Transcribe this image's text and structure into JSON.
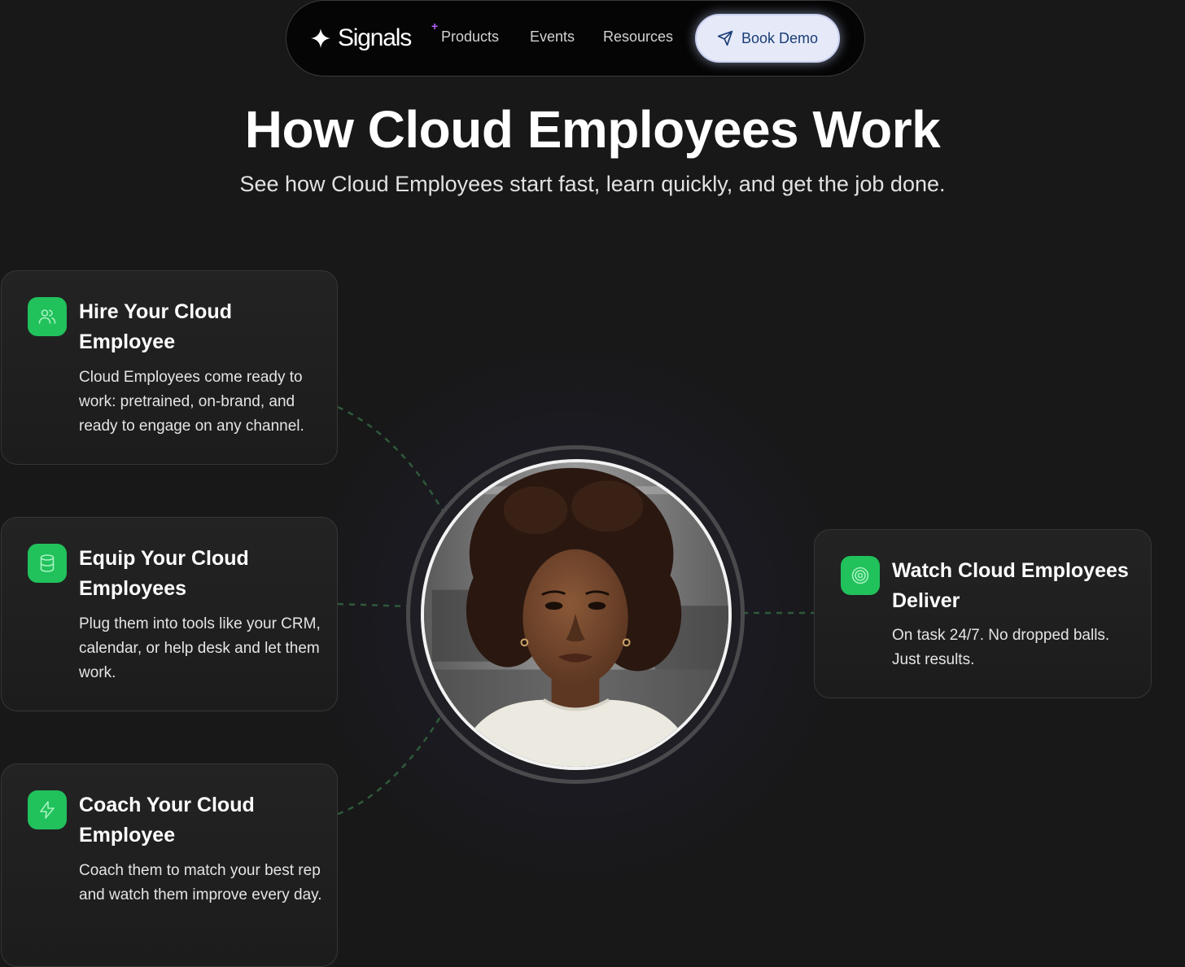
{
  "brand": {
    "name": "Signals",
    "accent": "#b061ff"
  },
  "nav": {
    "items": [
      {
        "label": "Products"
      },
      {
        "label": "Events"
      },
      {
        "label": "Resources"
      }
    ],
    "cta": {
      "label": "Book Demo",
      "icon": "send-icon"
    }
  },
  "hero": {
    "title": "How Cloud Employees Work",
    "subtitle": "See how Cloud Employees start fast, learn quickly, and get the job done."
  },
  "steps": [
    {
      "icon": "users-icon",
      "title": "Hire Your Cloud Employee",
      "description": "Cloud Employees come ready to work: pretrained, on-brand, and ready to engage on any channel."
    },
    {
      "icon": "database-icon",
      "title": "Equip Your Cloud Employees",
      "description": "Plug them into tools like your CRM, calendar, or help desk and let them work."
    },
    {
      "icon": "lightning-icon",
      "title": "Coach Your Cloud Employee",
      "description": "Coach them to match your best rep and watch them improve every day."
    },
    {
      "icon": "target-icon",
      "title": "Watch Cloud Employees Deliver",
      "description": "On task 24/7. No dropped balls. Just results."
    }
  ],
  "colors": {
    "background": "#181818",
    "icon_green": "#21c15c",
    "button_bg": "#e6eaf8",
    "button_text": "#1a3c77",
    "connector": "#2e5a3a"
  }
}
